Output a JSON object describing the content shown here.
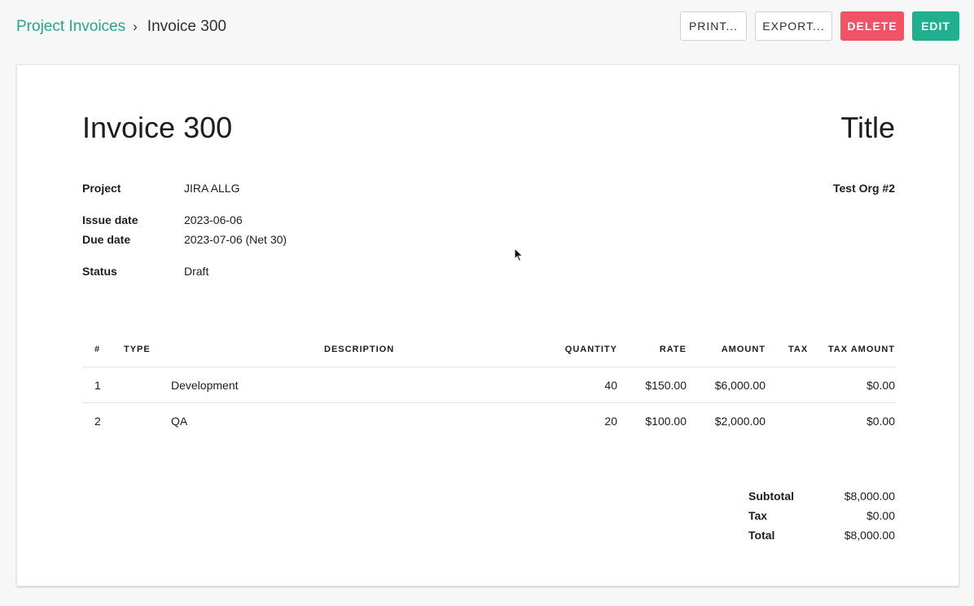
{
  "breadcrumb": {
    "parent": "Project Invoices",
    "separator": "›",
    "current": "Invoice 300"
  },
  "actions": {
    "print": "PRINT...",
    "export": "EXPORT...",
    "delete": "DELETE",
    "edit": "EDIT"
  },
  "colors": {
    "accent": "#23a78c",
    "delete": "#ef5365",
    "edit": "#21b08f"
  },
  "invoice": {
    "title": "Invoice 300",
    "doc_title": "Title",
    "organization": "Test Org #2",
    "meta": {
      "project_label": "Project",
      "project_value": "JIRA ALLG",
      "issue_label": "Issue date",
      "issue_value": "2023-06-06",
      "due_label": "Due date",
      "due_value": "2023-07-06 (Net 30)",
      "status_label": "Status",
      "status_value": "Draft"
    },
    "table": {
      "headers": [
        "#",
        "TYPE",
        "DESCRIPTION",
        "QUANTITY",
        "RATE",
        "AMOUNT",
        "TAX",
        "TAX AMOUNT"
      ],
      "rows": [
        {
          "num": "1",
          "type": "",
          "description": "Development",
          "quantity": "40",
          "rate": "$150.00",
          "amount": "$6,000.00",
          "tax": "",
          "tax_amount": "$0.00"
        },
        {
          "num": "2",
          "type": "",
          "description": "QA",
          "quantity": "20",
          "rate": "$100.00",
          "amount": "$2,000.00",
          "tax": "",
          "tax_amount": "$0.00"
        }
      ]
    },
    "totals": {
      "subtotal_label": "Subtotal",
      "subtotal_value": "$8,000.00",
      "tax_label": "Tax",
      "tax_value": "$0.00",
      "total_label": "Total",
      "total_value": "$8,000.00"
    }
  }
}
